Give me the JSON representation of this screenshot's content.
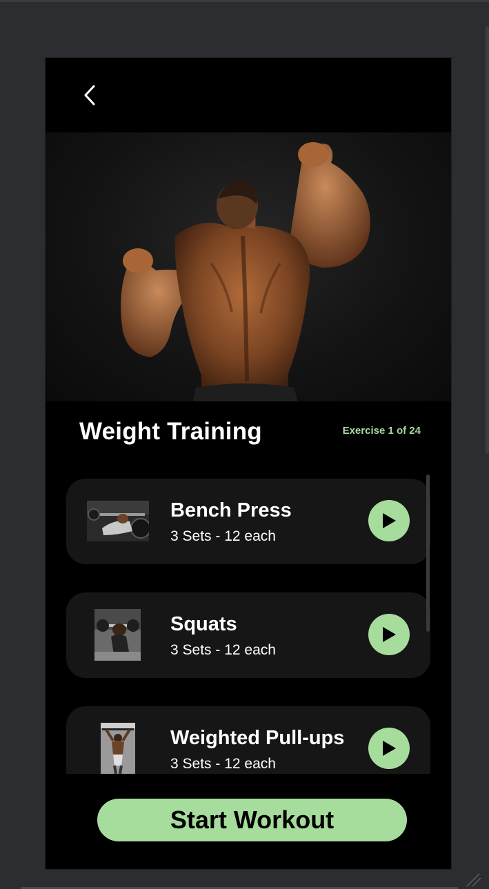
{
  "header": {
    "back_icon": "chevron-left-icon",
    "hero_image": "muscular man flexing back photo"
  },
  "workout": {
    "title": "Weight Training",
    "counter": "Exercise 1 of 24"
  },
  "exercises": [
    {
      "name": "Bench Press",
      "sets": "3 Sets - 12 each",
      "thumb": "bench press photo",
      "icon": "play-icon"
    },
    {
      "name": "Squats",
      "sets": "3 Sets - 12 each",
      "thumb": "squats photo",
      "icon": "play-icon"
    },
    {
      "name": "Weighted Pull-ups",
      "sets": "3 Sets - 12 each",
      "thumb": "pull-ups photo",
      "icon": "play-icon"
    }
  ],
  "footer": {
    "start_label": "Start Workout"
  },
  "colors": {
    "accent": "#a6dc9c",
    "background": "#000000",
    "card": "#161616",
    "editor_background": "#2c2d30"
  }
}
